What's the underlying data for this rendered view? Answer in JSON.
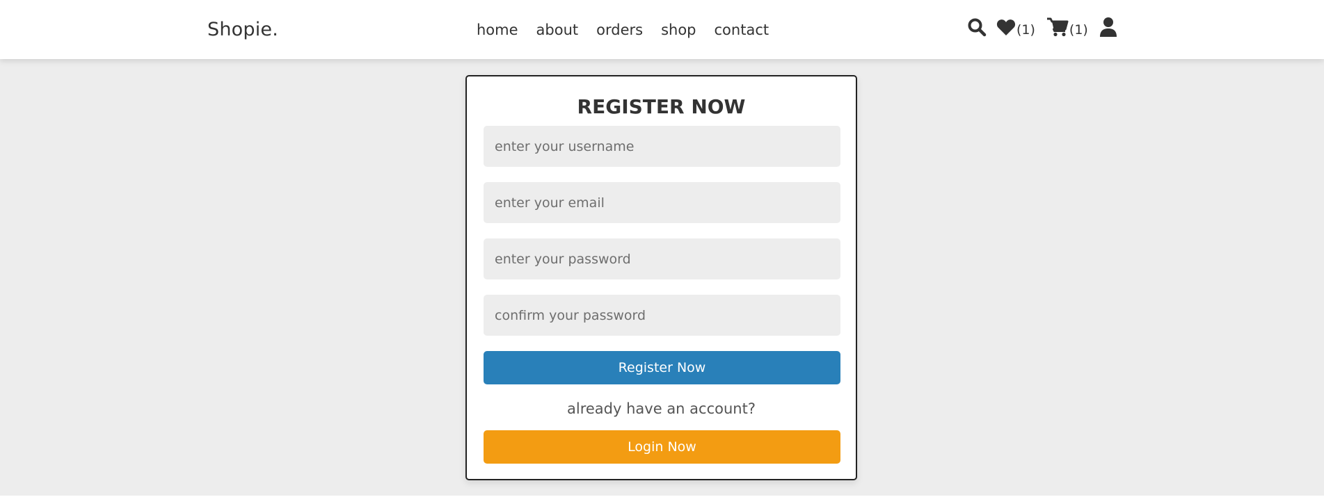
{
  "brand": {
    "name": "Shopie",
    "dot": "."
  },
  "nav": [
    {
      "label": "home"
    },
    {
      "label": "about"
    },
    {
      "label": "orders"
    },
    {
      "label": "shop"
    },
    {
      "label": "contact"
    }
  ],
  "header_icons": {
    "wishlist_count": "(1)",
    "cart_count": "(1)"
  },
  "register_form": {
    "title": "register now",
    "username_placeholder": "enter your username",
    "email_placeholder": "enter your email",
    "password_placeholder": "enter your password",
    "confirm_placeholder": "confirm your password",
    "register_button": "Register Now",
    "already_text": "already have an account?",
    "login_button": "Login Now"
  },
  "colors": {
    "accent_line": "#3d72b4",
    "register_button": "#2980b9",
    "login_button": "#f39c12",
    "background": "#ededed"
  }
}
